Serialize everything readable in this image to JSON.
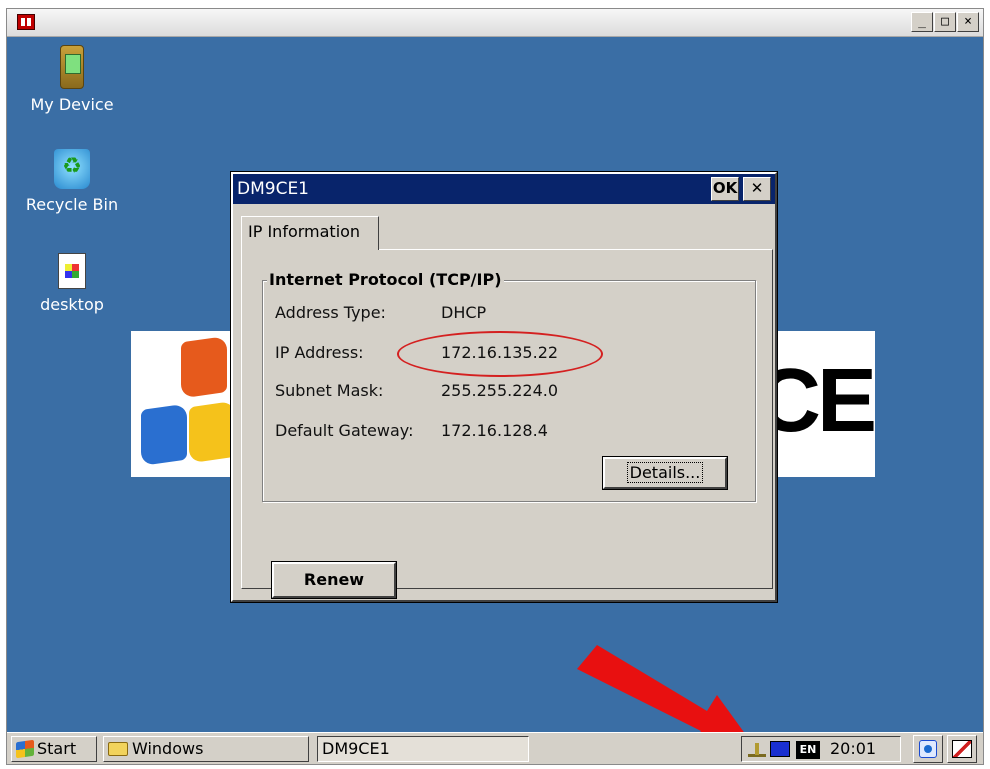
{
  "window": {
    "controls": {
      "minimize": "_",
      "maximize": "□",
      "close": "×"
    }
  },
  "desktop": {
    "icons": [
      {
        "label": "My Device",
        "icon": "device-icon"
      },
      {
        "label": "Recycle Bin",
        "icon": "recycle-bin-icon"
      },
      {
        "label": "desktop",
        "icon": "document-icon"
      }
    ],
    "banner_text": "CE"
  },
  "dialog": {
    "title": "DM9CE1",
    "ok_label": "OK",
    "close_label": "✕",
    "tab_label": "IP Information",
    "group_title": "Internet Protocol (TCP/IP)",
    "rows": [
      {
        "label": "Address Type:",
        "value": "DHCP"
      },
      {
        "label": "IP Address:",
        "value": "172.16.135.22"
      },
      {
        "label": "Subnet Mask:",
        "value": "255.255.224.0"
      },
      {
        "label": "Default Gateway:",
        "value": "172.16.128.4"
      }
    ],
    "details_label": "Details...",
    "renew_label": "Renew"
  },
  "taskbar": {
    "start_label": "Start",
    "buttons": [
      "Windows",
      "DM9CE1"
    ],
    "tray": {
      "language": "EN",
      "time": "20:01"
    }
  },
  "colors": {
    "desktop": "#3a6ea5",
    "titlebar": "#08246b",
    "highlight_ring": "#d42020",
    "arrow": "#e81010"
  }
}
